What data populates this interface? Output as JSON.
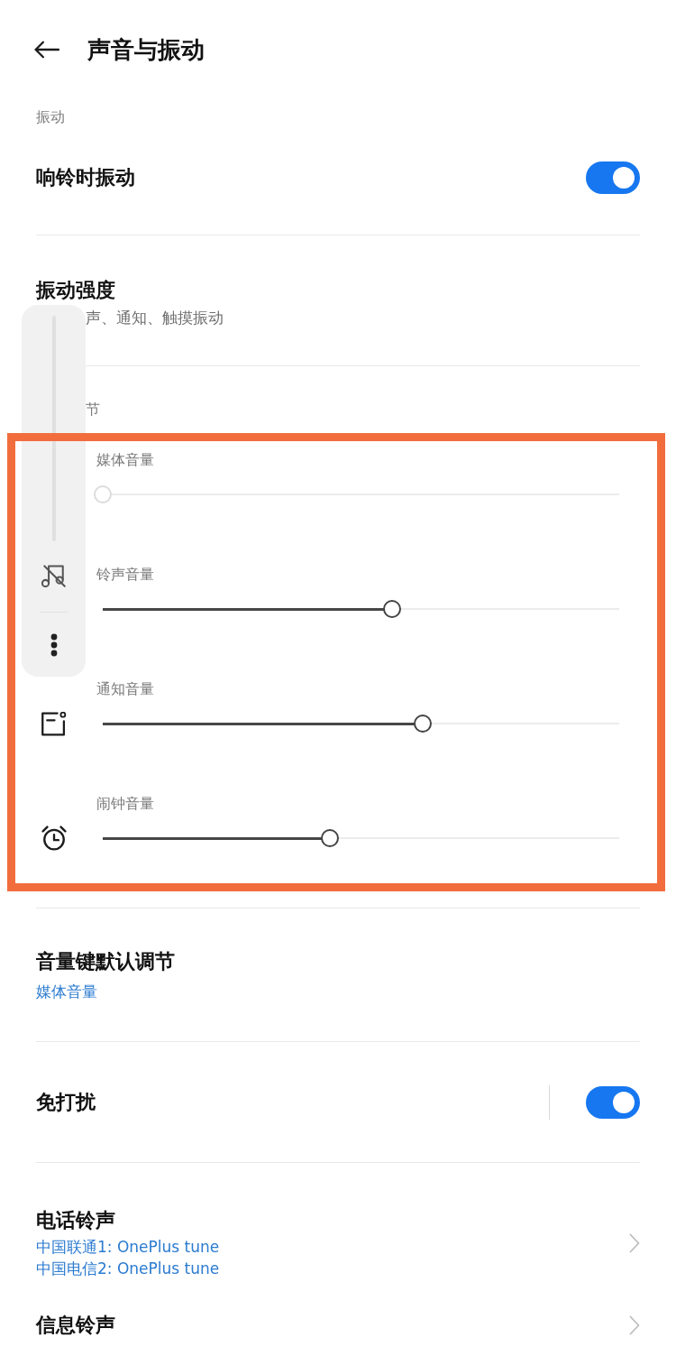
{
  "header": {
    "title": "声音与振动"
  },
  "vibration": {
    "heading": "振动",
    "rows": [
      {
        "kind": "toggle",
        "title": "响铃时振动",
        "on": true
      },
      {
        "kind": "detail",
        "title": "振动强度",
        "subtitle": "声、通知、触摸振动"
      }
    ]
  },
  "volume": {
    "heading": "节",
    "sliders": [
      {
        "kind": "media",
        "label": "媒体音量",
        "level": 0
      },
      {
        "kind": "ring",
        "label": "铃声音量",
        "level": 0.56
      },
      {
        "kind": "notification",
        "label": "通知音量",
        "level": 0.62
      },
      {
        "kind": "alarm",
        "label": "闹钟音量",
        "level": 0.44
      }
    ]
  },
  "more_settings": [
    [
      {
        "kind": "value",
        "title": "音量键默认调节",
        "values": [
          "媒体音量"
        ]
      }
    ],
    [
      {
        "kind": "split",
        "title": "免打扰",
        "on": true
      }
    ],
    [
      {
        "kind": "link",
        "title": "电话铃声",
        "values": [
          "中国联通1: OnePlus tune",
          "中国电信2: OnePlus tune"
        ]
      },
      {
        "kind": "link",
        "title": "信息铃声"
      }
    ]
  ]
}
